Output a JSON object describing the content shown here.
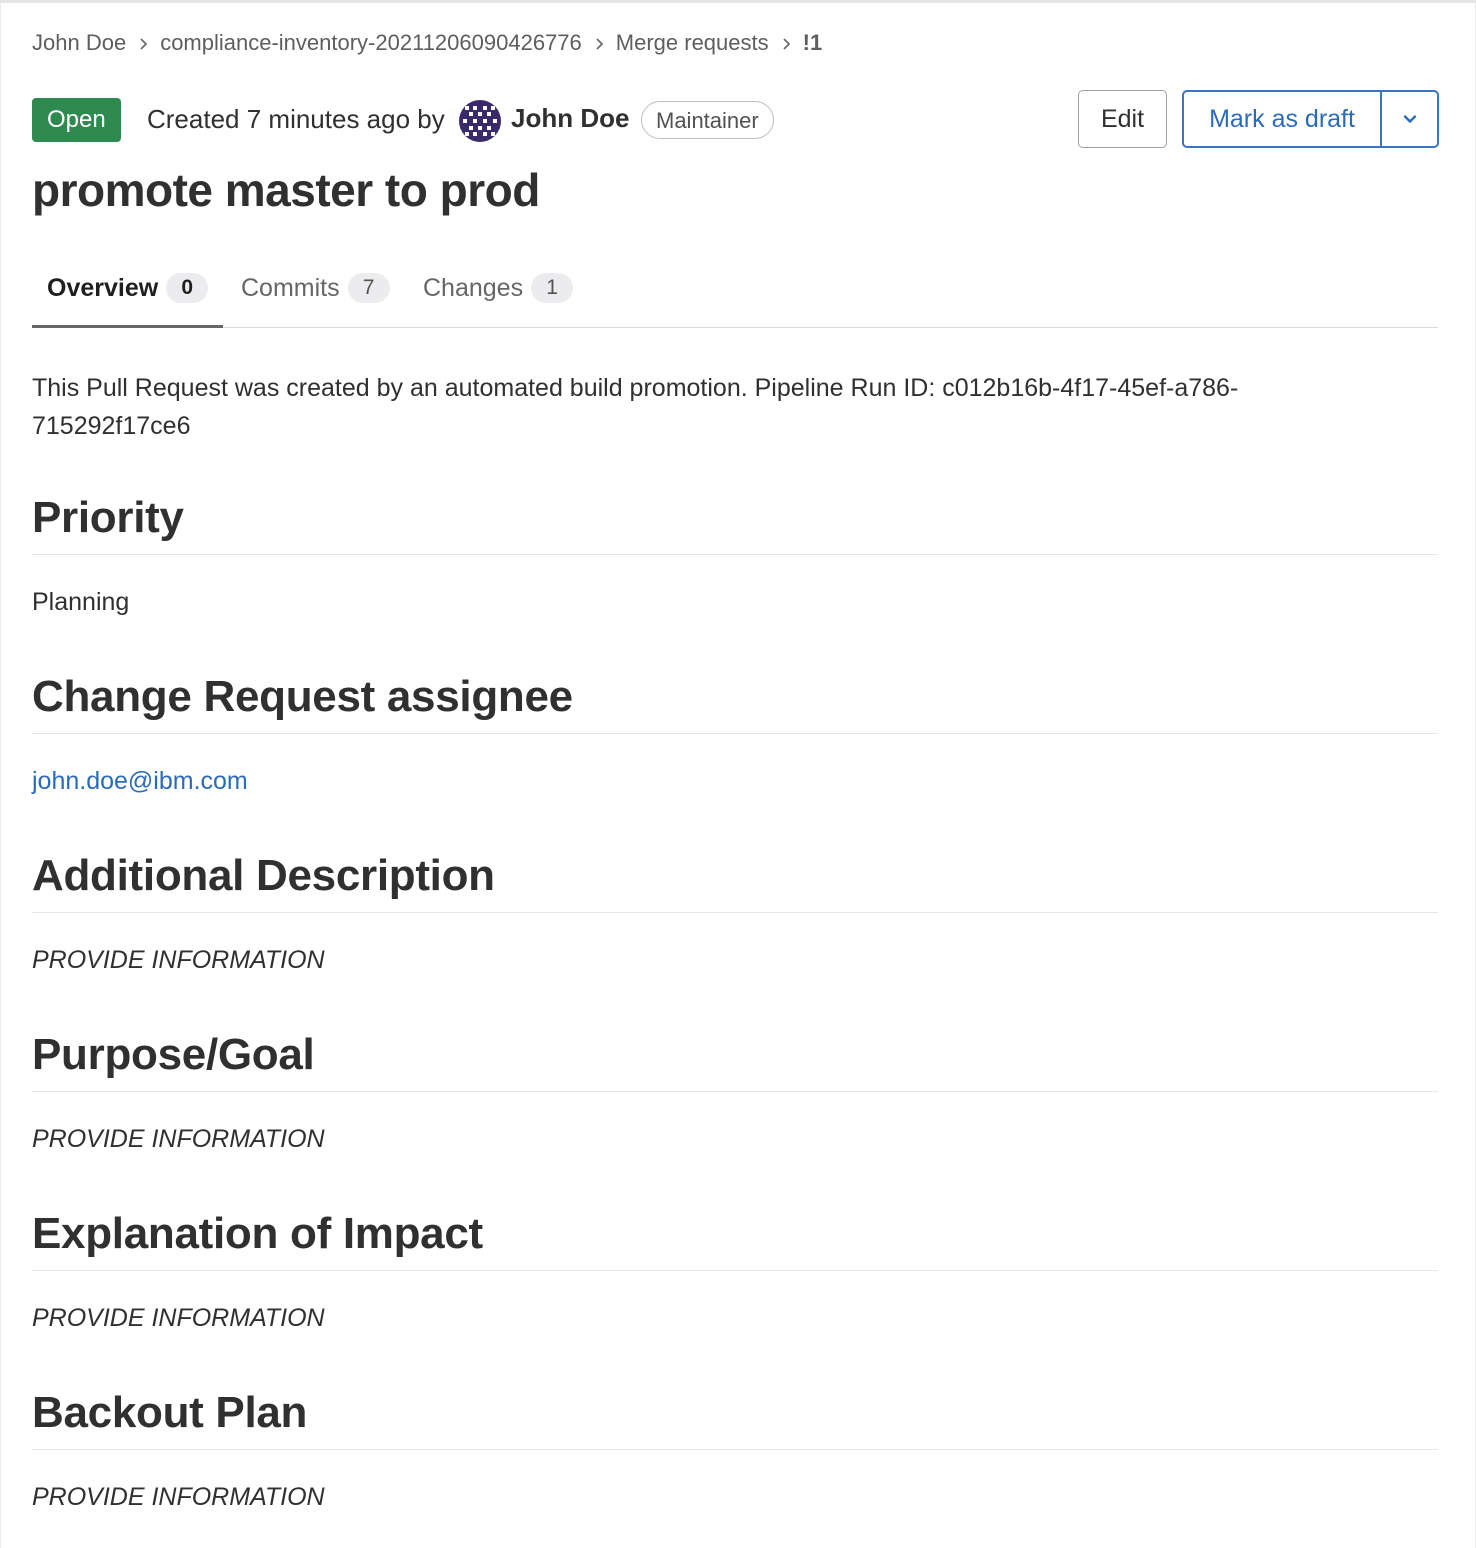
{
  "breadcrumb": {
    "items": [
      "John Doe",
      "compliance-inventory-20211206090426776",
      "Merge requests"
    ],
    "current": "!1"
  },
  "header": {
    "status": "Open",
    "created_text": "Created 7 minutes ago by",
    "author": "John Doe",
    "role": "Maintainer",
    "edit_label": "Edit",
    "draft_label": "Mark as draft"
  },
  "title": "promote master to prod",
  "tabs": [
    {
      "label": "Overview",
      "count": "0",
      "active": true
    },
    {
      "label": "Commits",
      "count": "7",
      "active": false
    },
    {
      "label": "Changes",
      "count": "1",
      "active": false
    }
  ],
  "description": {
    "intro": "This Pull Request was created by an automated build promotion. Pipeline Run ID: c012b16b-4f17-45ef-a786-715292f17ce6",
    "sections": [
      {
        "heading": "Priority",
        "body": "Planning"
      },
      {
        "heading": "Change Request assignee",
        "body": "john.doe@ibm.com"
      },
      {
        "heading": "Additional Description",
        "body": "PROVIDE INFORMATION"
      },
      {
        "heading": "Purpose/Goal",
        "body": "PROVIDE INFORMATION"
      },
      {
        "heading": "Explanation of Impact",
        "body": "PROVIDE INFORMATION"
      },
      {
        "heading": "Backout Plan",
        "body": "PROVIDE INFORMATION"
      }
    ]
  },
  "colors": {
    "status_open": "#2f8a4f",
    "link": "#2b6bbd",
    "primary_border": "#3a75c4",
    "avatar": "#3b2a6b"
  },
  "icons": {
    "breadcrumb_separator": "chevron-right-icon",
    "dropdown": "chevron-down-icon",
    "avatar": "identicon-avatar"
  }
}
